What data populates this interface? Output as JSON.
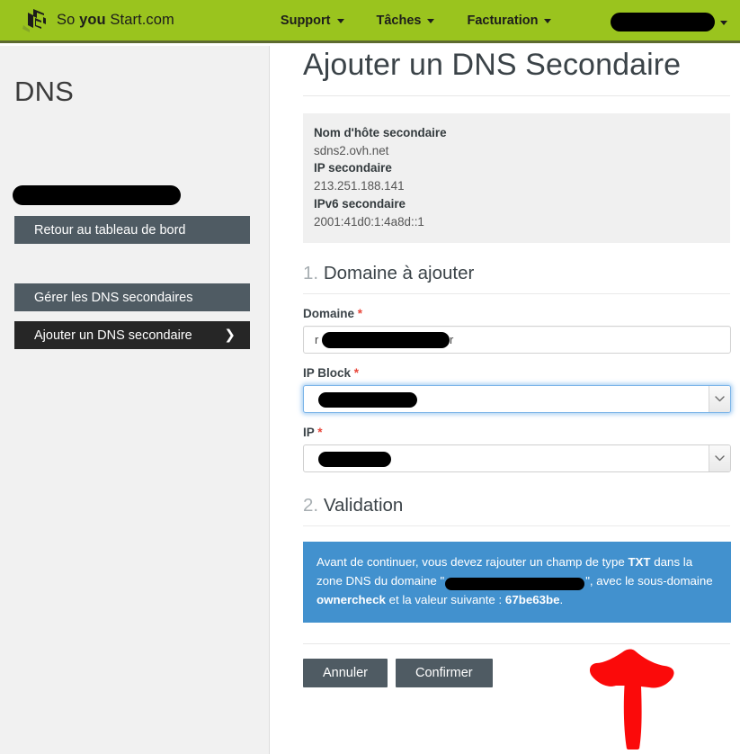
{
  "header": {
    "brand_prefix": "So ",
    "brand_bold": "you ",
    "brand_suffix": "Start.com",
    "logo_icon": "soyoustart-cube-logo",
    "nav": [
      {
        "label": "Support",
        "icon": "chevron-down-icon"
      },
      {
        "label": "Tâches",
        "icon": "chevron-down-icon"
      },
      {
        "label": "Facturation",
        "icon": "chevron-down-icon"
      }
    ],
    "user_menu": {
      "label": "",
      "redacted": true,
      "icon": "chevron-down-icon"
    },
    "background_color": "#9ac41e",
    "border_color": "#5d6a30"
  },
  "sidebar": {
    "title": "DNS",
    "account_name": "",
    "account_redacted": true,
    "items": [
      {
        "label": "Retour au tableau de bord",
        "state": "normal",
        "color": "#4f5b63"
      },
      {
        "label": "Gérer les DNS secondaires",
        "state": "normal",
        "color": "#4f5b63"
      },
      {
        "label": "Ajouter un DNS secondaire",
        "state": "active",
        "color": "#262626",
        "icon": "chevron-right-icon"
      }
    ],
    "chevron": "❯",
    "background_color": "#f1f1f1"
  },
  "main": {
    "page_title": "Ajouter un DNS Secondaire",
    "info_box": {
      "rows": [
        {
          "key": "Nom d'hôte secondaire",
          "value": "sdns2.ovh.net"
        },
        {
          "key": "IP secondaire",
          "value": "213.251.188.141"
        },
        {
          "key": "IPv6 secondaire",
          "value": "2001:41d0:1:4a8d::1"
        }
      ],
      "background_color": "#f0f0f0"
    },
    "sections": [
      {
        "number": "1.",
        "title": "Domaine à ajouter"
      },
      {
        "number": "2.",
        "title": "Validation"
      }
    ],
    "fields": {
      "domain": {
        "label": "Domaine",
        "required_marker": "*",
        "value": "",
        "value_redacted": true,
        "type": "text"
      },
      "ip_block": {
        "label": "IP Block",
        "required_marker": "*",
        "value": "",
        "value_redacted": true,
        "type": "select",
        "focused": true,
        "arrow_icon": "chevron-down-icon"
      },
      "ip": {
        "label": "IP",
        "required_marker": "*",
        "value": "",
        "value_redacted": true,
        "type": "select",
        "focused": false,
        "arrow_icon": "chevron-down-icon"
      }
    },
    "alert": {
      "text_1": "Avant de continuer, vous devez rajouter un champ de type ",
      "bold_1": "TXT",
      "text_2": " dans la zone DNS du domaine \"",
      "redacted_domain": "",
      "text_3": "\", avec le sous-domaine ",
      "bold_2": "ownercheck",
      "text_4": " et la valeur suivante : ",
      "bold_3": "67be63be",
      "text_5": ".",
      "background_color": "#4291ce"
    },
    "buttons": [
      {
        "label": "Annuler",
        "color": "#4f5b63"
      },
      {
        "label": "Confirmer",
        "color": "#4f5b63"
      }
    ]
  },
  "annotation": {
    "shape": "hand-drawn-up-arrow",
    "color": "#fb0a0a",
    "points_to": "67be63be"
  }
}
